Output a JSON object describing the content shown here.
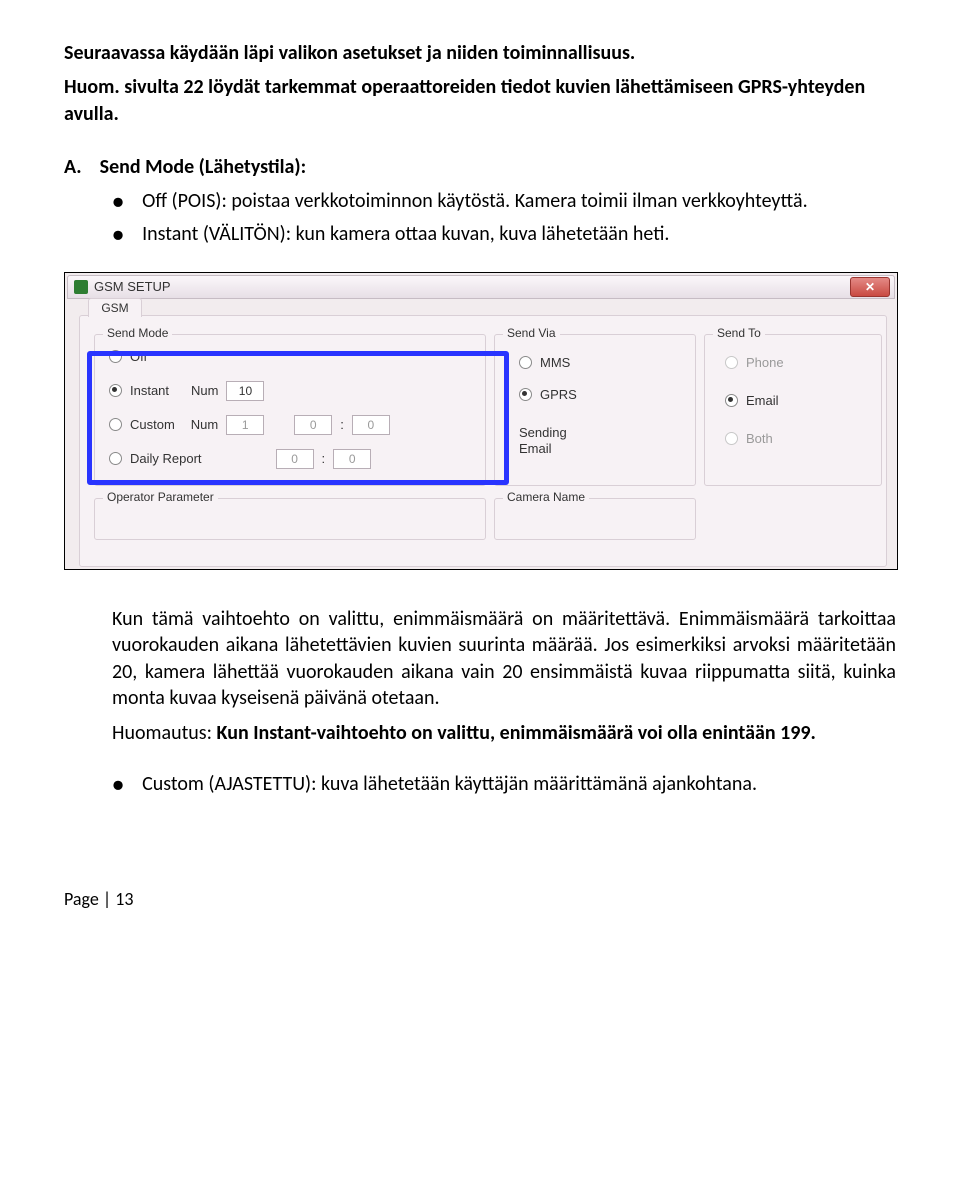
{
  "intro": {
    "line1": "Seuraavassa käydään läpi valikon asetukset ja niiden toiminnallisuus.",
    "line2": "Huom. sivulta 22 löydät tarkemmat operaattoreiden tiedot kuvien lähettämiseen GPRS-yhteyden avulla."
  },
  "section": {
    "letter": "A.",
    "title": "Send Mode (Lähetystila):"
  },
  "bullets_a": [
    "Off (POIS): poistaa verkkotoiminnon käytöstä. Kamera toimii ilman verkkoyhteyttä.",
    "Instant (VÄLITÖN): kun kamera ottaa kuvan, kuva lähetetään heti."
  ],
  "screenshot": {
    "title": "GSM SETUP",
    "tab": "GSM",
    "groups": {
      "sendmode": "Send Mode",
      "sendvia": "Send Via",
      "sendto": "Send To",
      "opparam": "Operator Parameter",
      "camname": "Camera Name"
    },
    "sendmode": {
      "off": "Off",
      "instant": "Instant",
      "num": "Num",
      "num_val": "10",
      "custom": "Custom",
      "custom_num": "1",
      "custom_h": "0",
      "custom_m": "0",
      "daily": "Daily Report",
      "daily_h": "0",
      "daily_m": "0"
    },
    "sendvia": {
      "mms": "MMS",
      "gprs": "GPRS",
      "sending": "Sending",
      "email": "Email"
    },
    "sendto": {
      "phone": "Phone",
      "email": "Email",
      "both": "Both"
    }
  },
  "para_after": {
    "p1": "Kun tämä vaihtoehto on valittu, enimmäismäärä on määritettävä. Enimmäismäärä tarkoittaa vuorokauden aikana lähetettävien kuvien suurinta määrää. Jos esimerkiksi arvoksi määritetään 20, kamera lähettää vuorokauden aikana vain 20 ensimmäistä kuvaa riippumatta siitä, kuinka monta kuvaa kyseisenä päivänä otetaan.",
    "p2a": "Huomautus: ",
    "p2b": "Kun Instant-vaihtoehto on valittu, enimmäismäärä voi olla enintään 199."
  },
  "bullet_custom": "Custom (AJASTETTU): kuva lähetetään käyttäjän määrittämänä ajankohtana.",
  "footer": "Page | 13"
}
